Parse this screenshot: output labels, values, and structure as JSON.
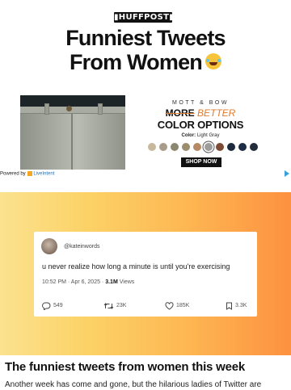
{
  "header": {
    "logo": "▮HUFFPOST▮",
    "title_line1": "Funniest Tweets",
    "title_line2": "From Women"
  },
  "ad": {
    "brand": "MOTT & BOW",
    "more": "MORE",
    "better": "BETTER",
    "headline": "COLOR OPTIONS",
    "color_label": "Color:",
    "color_value": "Light Gray",
    "swatches": [
      "#c8b99c",
      "#a89d8a",
      "#8c8770",
      "#9c8c6e",
      "#b58a63",
      "#9d9d9b",
      "#7d4a35",
      "#1d2b3c",
      "#1e2d46",
      "#232d3c"
    ],
    "selected_swatch_index": 5,
    "cta": "SHOP NOW",
    "powered_by": "Powered by",
    "powered_brand": "LiveIntent"
  },
  "tweet": {
    "handle": "@kateinwords",
    "text": "u never realize how long a minute is until you're exercising",
    "timestamp": "10:52 PM · Apr 6, 2025 ·",
    "views_count": "3.1M",
    "views_label": "Views",
    "replies": "549",
    "retweets": "23K",
    "likes": "185K",
    "bookmarks": "3.3K"
  },
  "article": {
    "title": "The funniest tweets from women this week",
    "body": "Another week has come and gone, but the hilarious ladies of Twitter are"
  }
}
